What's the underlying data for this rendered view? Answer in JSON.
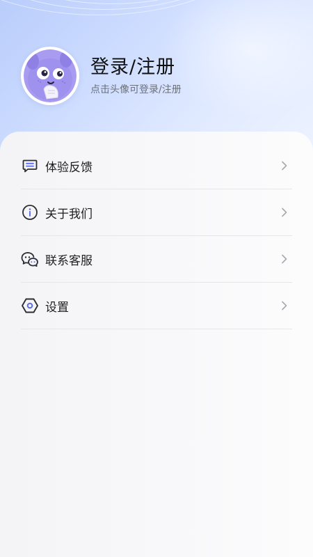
{
  "profile": {
    "title": "登录/注册",
    "subtitle": "点击头像可登录/注册",
    "avatar_icon": "cartoon-mascot-avatar"
  },
  "menu": {
    "items": [
      {
        "label": "体验反馈",
        "icon": "feedback-message-icon"
      },
      {
        "label": "关于我们",
        "icon": "info-circle-icon"
      },
      {
        "label": "联系客服",
        "icon": "customer-service-chat-icon"
      },
      {
        "label": "设置",
        "icon": "settings-hexagon-icon"
      }
    ],
    "chevron_icon": "chevron-right-icon"
  },
  "colors": {
    "header_gradient_start": "#b9cdfb",
    "header_gradient_end": "#eef3ff",
    "icon_dark": "#2b2d33",
    "icon_accent": "#5b6cf0",
    "chevron": "#a6a8ae"
  }
}
